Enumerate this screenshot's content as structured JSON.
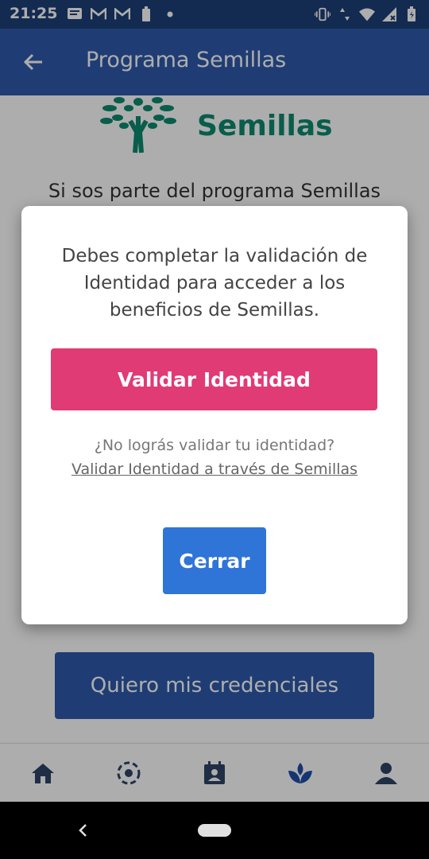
{
  "status_bar": {
    "time": "21:25",
    "left_icons": [
      "message-icon",
      "gmail-icon",
      "gmail-icon",
      "battery-saver-icon",
      "dot-icon"
    ],
    "right_icons": [
      "vibrate-icon",
      "data-icon",
      "wifi-icon",
      "signal-icon",
      "battery-icon"
    ]
  },
  "app_bar": {
    "title": "Programa Semillas",
    "back_icon": "arrow-back-icon"
  },
  "content": {
    "logo_text": "Semillas",
    "intro": "Si sos parte del programa Semillas",
    "credentials_button": "Quiero mis credenciales"
  },
  "dialog": {
    "message": "Debes completar la validación de Identidad para acceder a los beneficios de Semillas.",
    "validate_button": "Validar Identidad",
    "help_question": "¿No lográs validar tu identidad?",
    "help_link": "Validar Identidad a través de Semillas",
    "close_button": "Cerrar"
  },
  "bottom_nav": {
    "items": [
      "home-icon",
      "scan-icon",
      "calendar-badge-icon",
      "semillas-icon",
      "profile-icon"
    ],
    "active_index": 3
  },
  "colors": {
    "primary": "#2e5aac",
    "status": "#1d4078",
    "accent_pink": "#e03b74",
    "button_blue": "#2f74d7",
    "brand_green": "#0d8a6f"
  }
}
